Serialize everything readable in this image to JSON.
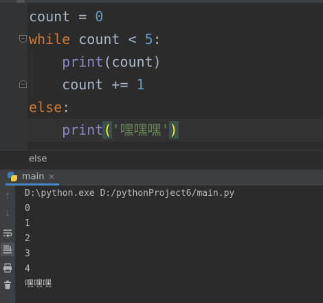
{
  "editor": {
    "lines": [
      {
        "parts": [
          {
            "t": "count = ",
            "c": ""
          },
          {
            "t": "0",
            "c": "num"
          }
        ]
      },
      {
        "parts": [
          {
            "t": "while",
            "c": "kw"
          },
          {
            "t": " count < ",
            "c": ""
          },
          {
            "t": "5",
            "c": "num"
          },
          {
            "t": ":",
            "c": ""
          }
        ]
      },
      {
        "parts": [
          {
            "t": "    ",
            "c": ""
          },
          {
            "t": "print",
            "c": "fn"
          },
          {
            "t": "(count)",
            "c": ""
          }
        ]
      },
      {
        "parts": [
          {
            "t": "    count += ",
            "c": ""
          },
          {
            "t": "1",
            "c": "num"
          }
        ]
      },
      {
        "parts": [
          {
            "t": "else",
            "c": "kw"
          },
          {
            "t": ":",
            "c": ""
          }
        ]
      },
      {
        "parts": [
          {
            "t": "    ",
            "c": ""
          },
          {
            "t": "print",
            "c": "fn"
          },
          {
            "t": "(",
            "c": "paren-hl"
          },
          {
            "t": "'嘿嘿嘿'",
            "c": "str"
          },
          {
            "t": ")",
            "c": "paren-hl"
          }
        ]
      }
    ],
    "current_line": 5
  },
  "breadcrumb": {
    "label": "else"
  },
  "run": {
    "tab_label": "main",
    "console_lines": [
      "D:\\python.exe D:/pythonProject6/main.py",
      "0",
      "1",
      "2",
      "3",
      "4",
      "嘿嘿嘿"
    ]
  },
  "toolbar_icons": [
    "rerun-up-icon",
    "rerun-down-icon",
    "soft-wrap-icon",
    "scroll-to-end-icon",
    "print-icon",
    "trash-icon"
  ]
}
